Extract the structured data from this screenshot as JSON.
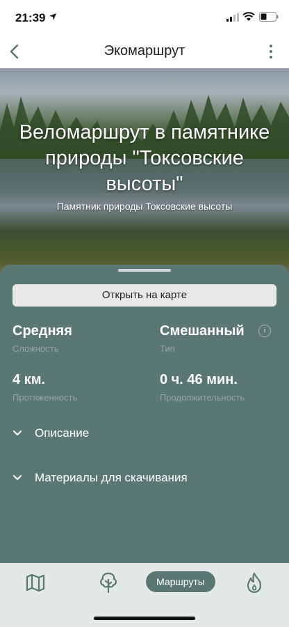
{
  "status_bar": {
    "time": "21:39"
  },
  "nav": {
    "title": "Экомаршрут",
    "back_icon": "chevron-left-icon",
    "more_icon": "more-vertical-icon"
  },
  "hero": {
    "title": "Веломаршрут в памятнике природы \"Токсовские высоты\"",
    "subtitle": "Памятник природы Токсовские высоты"
  },
  "sheet": {
    "map_button_label": "Открыть на карте",
    "difficulty": {
      "value": "Средняя",
      "label": "Сложность"
    },
    "type": {
      "value": "Смешанный",
      "label": "Тип"
    },
    "length": {
      "value": "4 км.",
      "label": "Протяженность"
    },
    "duration": {
      "value": "0 ч. 46 мин.",
      "label": "Продолжительность"
    },
    "sections": [
      {
        "label": "Описание"
      },
      {
        "label": "Материалы для скачивания"
      }
    ]
  },
  "tab_bar": {
    "active_label": "Маршруты",
    "icons": [
      "map-icon",
      "tree-icon",
      "fire-icon"
    ]
  },
  "colors": {
    "accent": "#5a7773",
    "tab_bar_bg": "#e3e9e6",
    "muted_label": "#8fa6a3"
  }
}
